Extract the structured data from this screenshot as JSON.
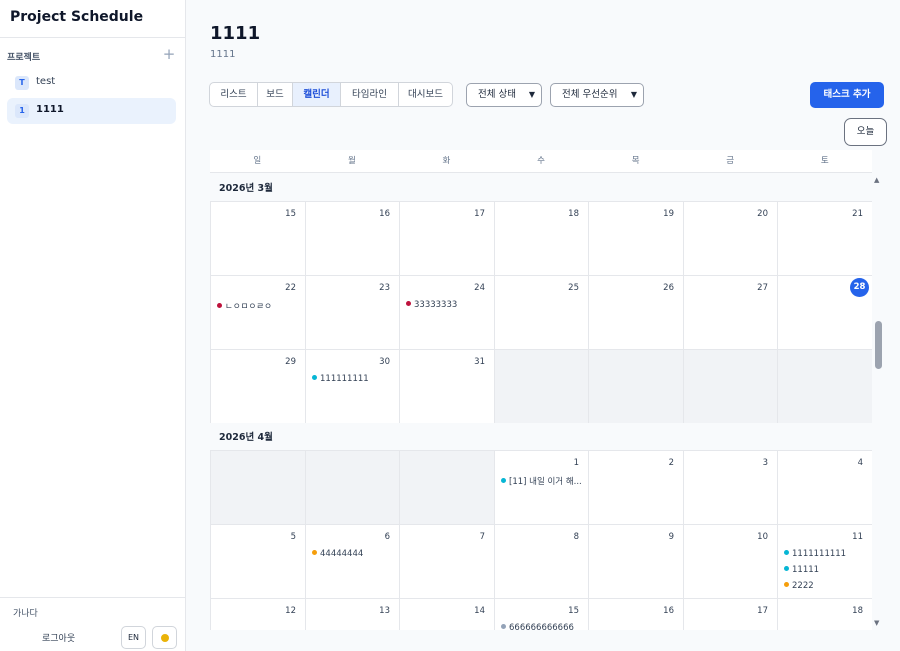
{
  "app": {
    "title": "Project Schedule"
  },
  "sidebar": {
    "section_label": "프로젝트",
    "add_icon": "+",
    "projects": [
      {
        "badge": "T",
        "name": "test",
        "active": false
      },
      {
        "badge": "1",
        "name": "1111",
        "active": true
      }
    ],
    "user_name": "가나다",
    "logout_label": "로그아웃",
    "lang_label": "EN",
    "theme_icon": "sun-icon"
  },
  "project": {
    "title": "1111",
    "subtitle": "1111"
  },
  "toolbar": {
    "views": [
      "리스트",
      "보드",
      "캘린더",
      "타임라인",
      "대시보드"
    ],
    "active_view": "캘린더",
    "status_filter": "전체 상태",
    "priority_filter": "전체 우선순위",
    "add_task_label": "태스크 추가",
    "today_label": "오늘"
  },
  "calendar": {
    "weekdays": [
      "일",
      "월",
      "화",
      "수",
      "목",
      "금",
      "토"
    ],
    "months": [
      {
        "label": "2026년 3월",
        "weeks": [
          [
            {
              "day": "15"
            },
            {
              "day": "16"
            },
            {
              "day": "17"
            },
            {
              "day": "18"
            },
            {
              "day": "19"
            },
            {
              "day": "20"
            },
            {
              "day": "21"
            }
          ],
          [
            {
              "day": "22",
              "events": [
                {
                  "text": "ㄴㅇㅁㅇㄹㅇ",
                  "color": "#be123c"
                }
              ]
            },
            {
              "day": "23"
            },
            {
              "day": "24",
              "events": [
                {
                  "text": "33333333",
                  "color": "#be123c"
                }
              ]
            },
            {
              "day": "25"
            },
            {
              "day": "26"
            },
            {
              "day": "27"
            },
            {
              "day": "28",
              "today": true
            }
          ],
          [
            {
              "day": "29"
            },
            {
              "day": "30",
              "events": [
                {
                  "text": "111111111",
                  "color": "#06b6d4"
                }
              ]
            },
            {
              "day": "31"
            },
            {
              "empty": true
            },
            {
              "empty": true
            },
            {
              "empty": true
            },
            {
              "empty": true
            }
          ]
        ]
      },
      {
        "label": "2026년 4월",
        "weeks": [
          [
            {
              "empty": true
            },
            {
              "empty": true
            },
            {
              "empty": true
            },
            {
              "day": "1",
              "events": [
                {
                  "text": "[11] 내일 이거 해...",
                  "color": "#06b6d4"
                }
              ]
            },
            {
              "day": "2"
            },
            {
              "day": "3"
            },
            {
              "day": "4"
            }
          ],
          [
            {
              "day": "5"
            },
            {
              "day": "6",
              "events": [
                {
                  "text": "44444444",
                  "color": "#f59e0b"
                }
              ]
            },
            {
              "day": "7"
            },
            {
              "day": "8"
            },
            {
              "day": "9"
            },
            {
              "day": "10"
            },
            {
              "day": "11",
              "events": [
                {
                  "text": "1111111111",
                  "color": "#06b6d4"
                },
                {
                  "text": "11111",
                  "color": "#06b6d4"
                },
                {
                  "text": "2222",
                  "color": "#f59e0b"
                }
              ]
            }
          ],
          [
            {
              "day": "12"
            },
            {
              "day": "13"
            },
            {
              "day": "14"
            },
            {
              "day": "15",
              "events": [
                {
                  "text": "666666666666",
                  "color": "#94a3b8"
                }
              ]
            },
            {
              "day": "16"
            },
            {
              "day": "17"
            },
            {
              "day": "18"
            }
          ]
        ]
      }
    ]
  }
}
